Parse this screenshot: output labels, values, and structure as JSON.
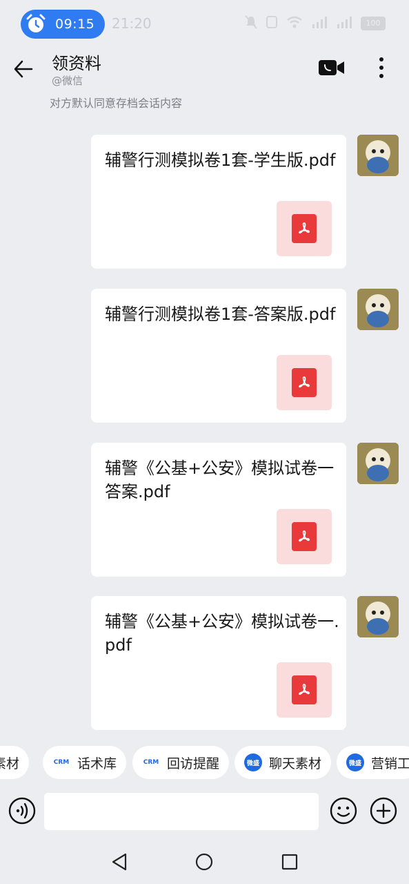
{
  "status_bar": {
    "alarm_time": "09:15",
    "clock": "21:20",
    "battery": "100"
  },
  "header": {
    "title": "领资料",
    "subtitle": "@微信",
    "archive_note": "对方默认同意存档会话内容"
  },
  "messages": [
    {
      "file_name": "辅警行测模拟卷1套-学生版.pdf",
      "file_type": "pdf-icon"
    },
    {
      "file_name": "辅警行测模拟卷1套-答案版.pdf",
      "file_type": "pdf-icon"
    },
    {
      "file_name": "辅警《公基+公安》模拟试卷一答案.pdf",
      "file_type": "pdf-icon"
    },
    {
      "file_name": "辅警《公基+公安》模拟试卷一.pdf",
      "file_type": "pdf-icon"
    }
  ],
  "quick_tools": [
    {
      "label": "素材",
      "logo": ""
    },
    {
      "label": "话术库",
      "logo": "CRM"
    },
    {
      "label": "回访提醒",
      "logo": "CRM"
    },
    {
      "label": "聊天素材",
      "logo": "微盛"
    },
    {
      "label": "营销工",
      "logo": "微盛"
    }
  ],
  "input": {
    "placeholder": ""
  },
  "colors": {
    "background": "#ebedf0",
    "accent": "#2f7bf2",
    "pdf_red": "#e83a3a",
    "pdf_bg": "#fbdcdc"
  }
}
